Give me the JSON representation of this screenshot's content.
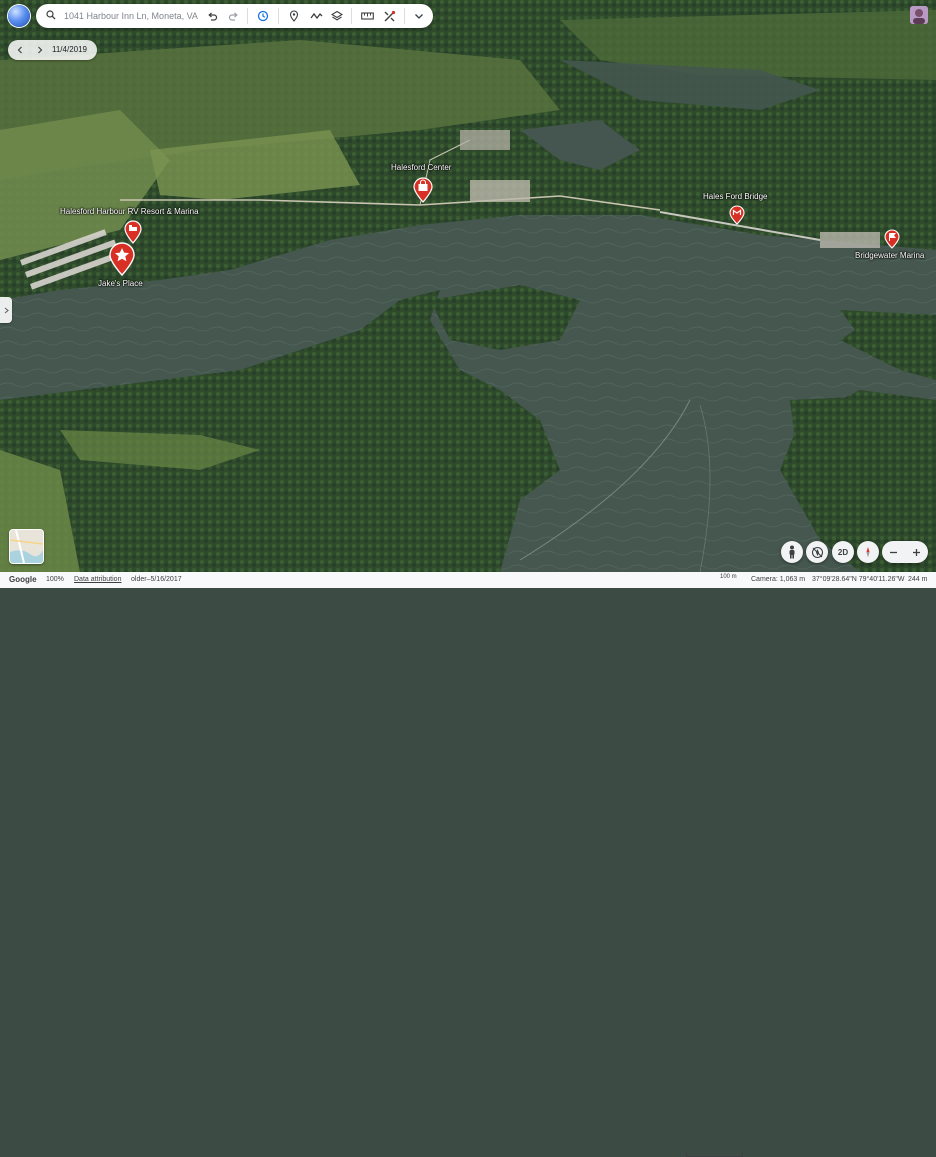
{
  "search": {
    "placeholder": "1041 Harbour Inn Ln, Moneta, VA"
  },
  "toolbar": {
    "icons": [
      "search-icon",
      "undo-icon",
      "redo-icon",
      "timelapse-icon",
      "pin-icon",
      "path-icon",
      "layers-icon",
      "measure-icon",
      "satellite-icon",
      "chevron-down-icon"
    ]
  },
  "timeline": {
    "date": "11/4/2019"
  },
  "places": [
    {
      "name": "Halesford Harbour RV Resort & Marina",
      "icon": "lodging"
    },
    {
      "name": "Jake's Place",
      "icon": "starred"
    },
    {
      "name": "Halesford Center",
      "icon": "shopping"
    },
    {
      "name": "Hales Ford Bridge",
      "icon": "landmark"
    },
    {
      "name": "Bridgewater Marina",
      "icon": "flag"
    }
  ],
  "controls": {
    "two_d_label": "2D"
  },
  "status": {
    "brand": "Google",
    "zoom_percent": "100%",
    "attribution": "Data attribution",
    "imagery_date": "older–5/16/2017",
    "scale": "100 m",
    "camera": "Camera: 1,063 m",
    "coords": "37°09'28.64\"N 79°40'11.26\"W",
    "elevation": "244 m"
  },
  "colors": {
    "water": "#44564f",
    "forest": "#2e4a2a",
    "field": "#6c8a4a",
    "pin_red": "#d93025",
    "accent_blue": "#1a73e8"
  }
}
